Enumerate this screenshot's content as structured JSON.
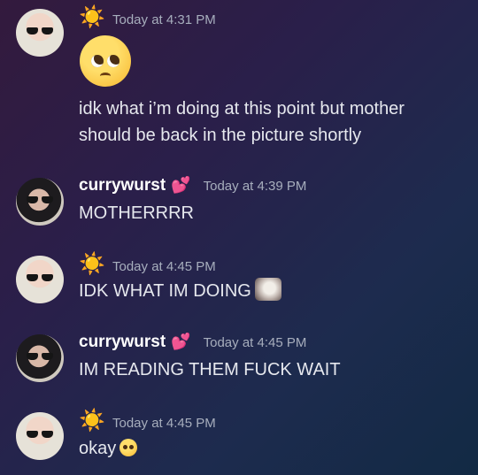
{
  "messages": [
    {
      "author_emoji": "☀️",
      "timestamp": "Today at 4:31 PM",
      "emoji": "🥺",
      "text_line1": "idk what i’m doing at this point but mother",
      "text_line2": "should be back in the picture shortly"
    },
    {
      "author": "currywurst",
      "author_emoji": "💕",
      "timestamp": "Today at 4:39 PM",
      "text": "MOTHERRRR"
    },
    {
      "author_emoji": "☀️",
      "timestamp": "Today at 4:45 PM",
      "text": "IDK WHAT IM DOING"
    },
    {
      "author": "currywurst",
      "author_emoji": "💕",
      "timestamp": "Today at 4:45 PM",
      "text": "IM READING THEM FUCK WAIT"
    },
    {
      "author_emoji": "☀️",
      "timestamp": "Today at 4:45 PM",
      "text": "okay"
    }
  ],
  "colors": {
    "text": "#e6e8ee",
    "timestamp": "#a7aebd",
    "username": "#ffffff"
  }
}
